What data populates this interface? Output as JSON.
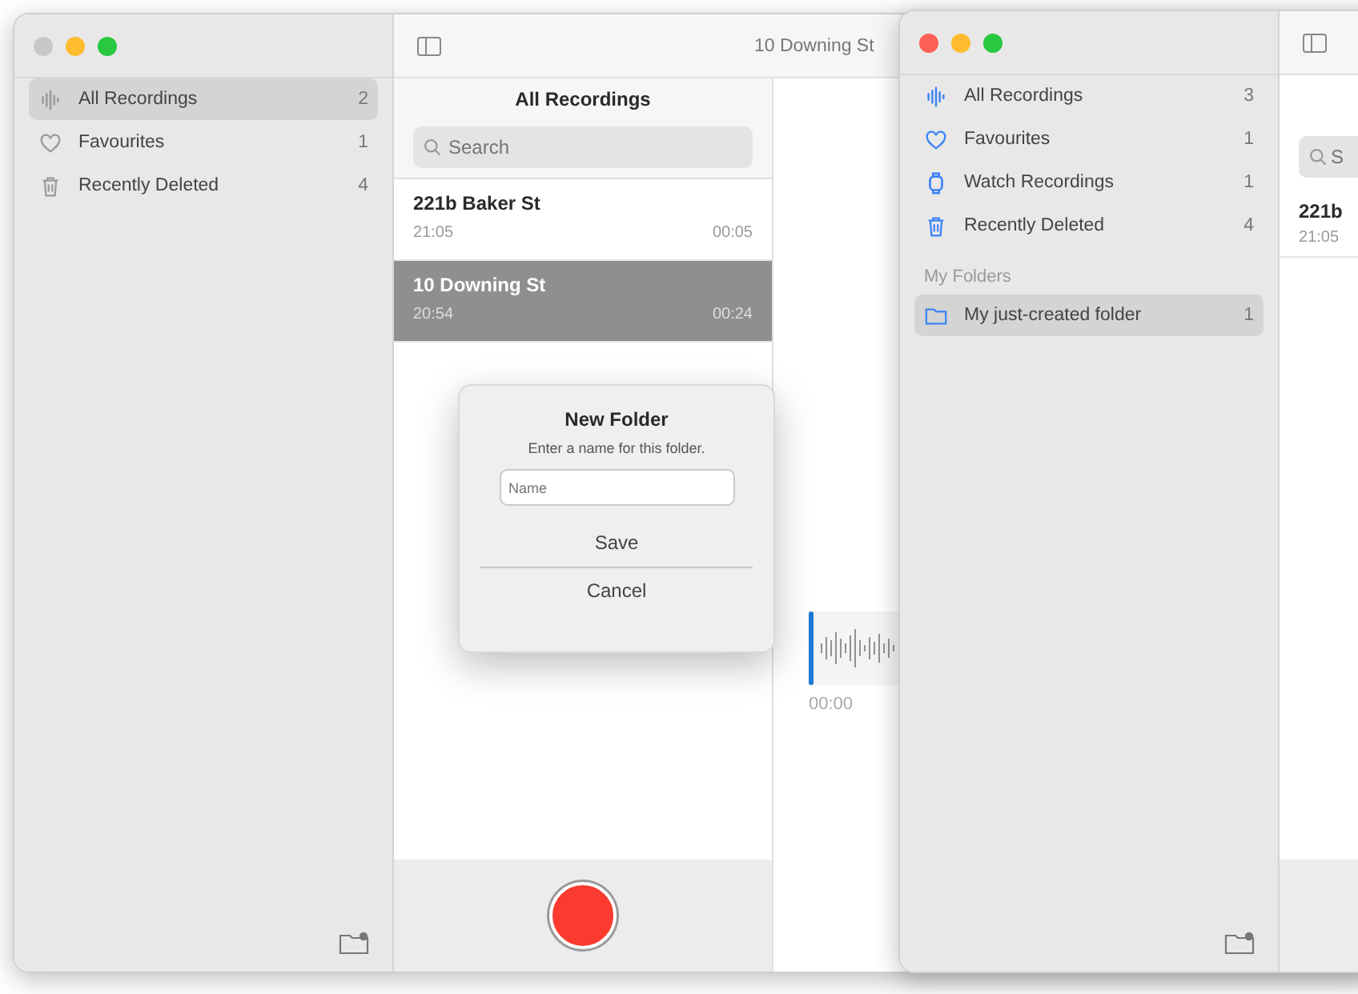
{
  "back_window": {
    "focused": false,
    "title": "10 Downing St",
    "sidebar": {
      "items": [
        {
          "kind": "waveform",
          "label": "All Recordings",
          "count": "2",
          "selected": true
        },
        {
          "kind": "heart",
          "label": "Favourites",
          "count": "1",
          "selected": false
        },
        {
          "kind": "trash",
          "label": "Recently Deleted",
          "count": "4",
          "selected": false
        }
      ]
    },
    "list": {
      "heading": "All Recordings",
      "search": {
        "placeholder": "Search"
      },
      "recordings": [
        {
          "title": "221b Baker St",
          "time": "21:05",
          "duration": "00:05",
          "selected": false
        },
        {
          "title": "10 Downing St",
          "time": "20:54",
          "duration": "00:24",
          "selected": true
        }
      ]
    },
    "detail": {
      "playhead_time": "00:00"
    }
  },
  "dialog": {
    "title": "New Folder",
    "message": "Enter a name for this folder.",
    "field": {
      "placeholder": "Name"
    },
    "buttons": [
      {
        "label": "Save",
        "kind": "save"
      },
      {
        "label": "Cancel",
        "kind": "cancel"
      }
    ]
  },
  "front_window": {
    "focused": true,
    "sidebar": {
      "items": [
        {
          "kind": "waveform",
          "label": "All Recordings",
          "count": "3",
          "selected": false
        },
        {
          "kind": "heart",
          "label": "Favourites",
          "count": "1",
          "selected": false
        },
        {
          "kind": "watch",
          "label": "Watch Recordings",
          "count": "1",
          "selected": false
        },
        {
          "kind": "trash",
          "label": "Recently Deleted",
          "count": "4",
          "selected": false
        }
      ],
      "section": "My Folders",
      "folders": [
        {
          "kind": "folder",
          "label": "My just-created folder",
          "count": "1",
          "selected": true
        }
      ]
    },
    "list": {
      "search": {
        "placeholder": "S"
      },
      "recordings": [
        {
          "title": "221b",
          "time": "21:05"
        }
      ]
    }
  }
}
